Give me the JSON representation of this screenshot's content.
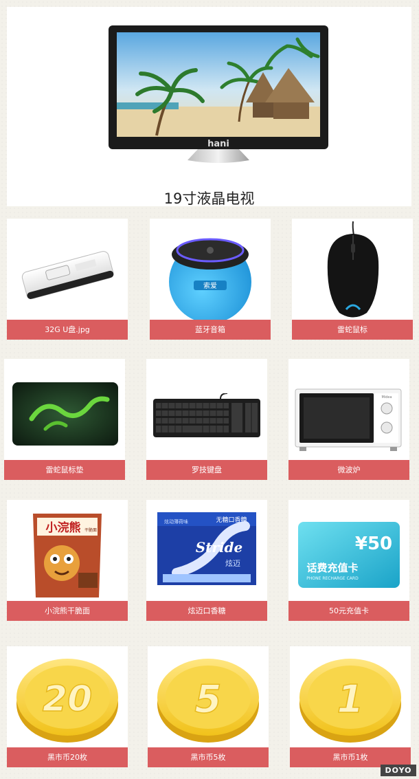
{
  "hero": {
    "title": "19寸液晶电视",
    "brand_text": "hani"
  },
  "items": [
    {
      "label": "32G U盘.jpg",
      "icon": "usb-drive"
    },
    {
      "label": "蓝牙音箱",
      "icon": "bluetooth-speaker",
      "brand_text": "索爱"
    },
    {
      "label": "雷蛇鼠标",
      "icon": "razer-mouse"
    },
    {
      "label": "雷蛇鼠标垫",
      "icon": "razer-mousepad"
    },
    {
      "label": "罗技键盘",
      "icon": "logitech-keyboard"
    },
    {
      "label": "微波炉",
      "icon": "microwave-oven",
      "brand_text": "Midea"
    },
    {
      "label": "小浣熊干脆面",
      "icon": "snack-noodles",
      "brand_text": "小浣熊",
      "sub_text": "干脆面"
    },
    {
      "label": "炫迈口香糖",
      "icon": "stride-gum",
      "brand_text": "Stride",
      "sub_text": "无糖口香糖",
      "side_text": "炫动薄荷味",
      "cn_brand": "炫迈"
    },
    {
      "label": "50元充值卡",
      "icon": "recharge-card",
      "amount_text": "¥50",
      "card_title": "话费充值卡",
      "card_sub": "PHONE RECHARGE CARD"
    },
    {
      "label": "黑市币20枚",
      "icon": "gold-coin",
      "coin_text": "20"
    },
    {
      "label": "黑市币5枚",
      "icon": "gold-coin",
      "coin_text": "5"
    },
    {
      "label": "黑市币1枚",
      "icon": "gold-coin",
      "coin_text": "1"
    }
  ],
  "watermark": "DOYO",
  "colors": {
    "label_bg": "#da5d5f",
    "background": "#f3f1ea",
    "card_bg": "#ffffff"
  }
}
